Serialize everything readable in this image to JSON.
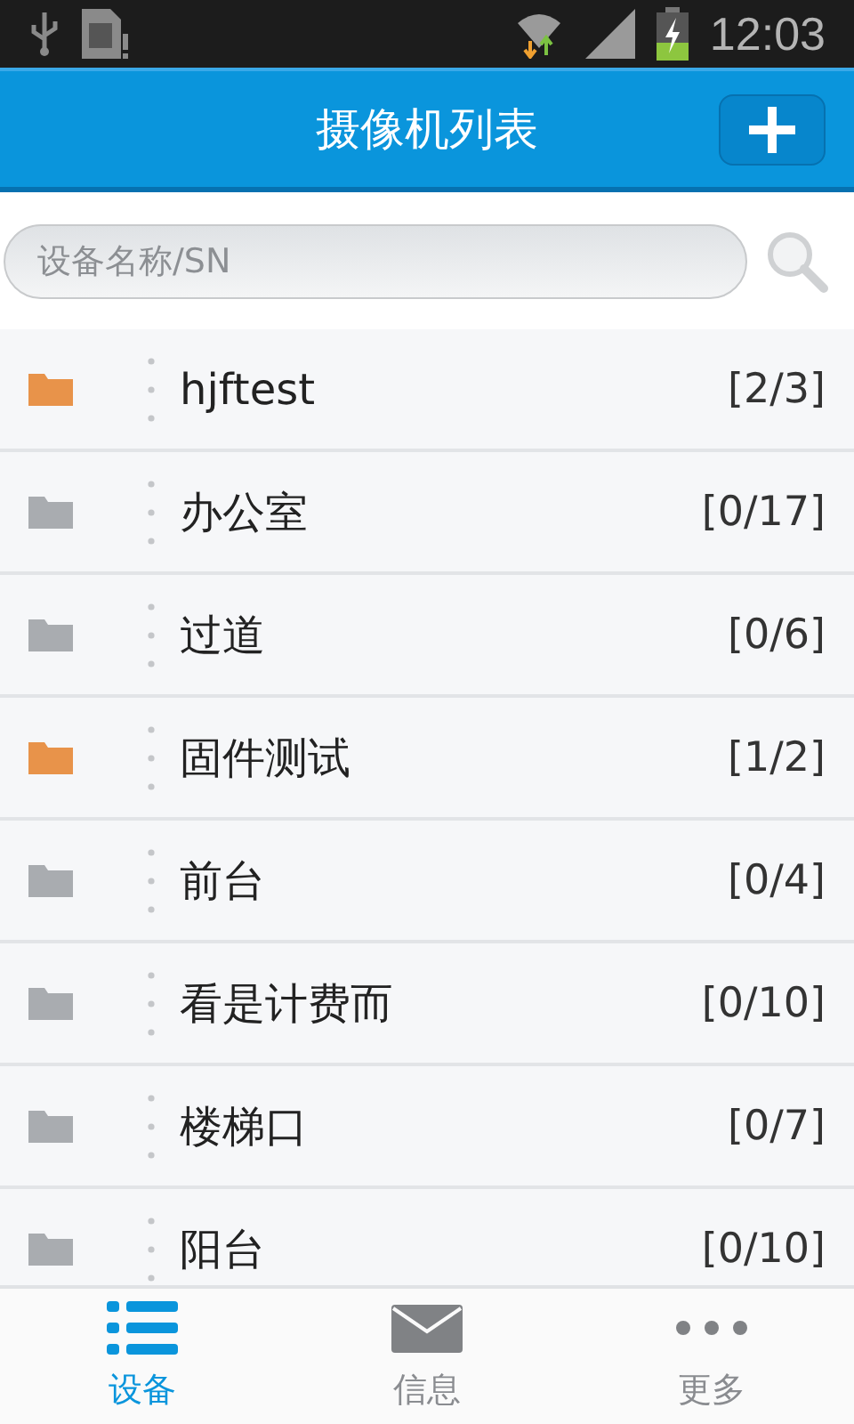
{
  "status_bar": {
    "time": "12:03"
  },
  "header": {
    "title": "摄像机列表"
  },
  "search": {
    "placeholder": "设备名称/SN"
  },
  "devices": [
    {
      "name": "hjftest",
      "count": "[2/3]",
      "color": "#e8934a"
    },
    {
      "name": "办公室",
      "count": "[0/17]",
      "color": "#a9acb0"
    },
    {
      "name": "过道",
      "count": "[0/6]",
      "color": "#a9acb0"
    },
    {
      "name": "固件测试",
      "count": "[1/2]",
      "color": "#e8934a"
    },
    {
      "name": "前台",
      "count": "[0/4]",
      "color": "#a9acb0"
    },
    {
      "name": "看是计费而",
      "count": "[0/10]",
      "color": "#a9acb0"
    },
    {
      "name": "楼梯口",
      "count": "[0/7]",
      "color": "#a9acb0"
    },
    {
      "name": "阳台",
      "count": "[0/10]",
      "color": "#a9acb0"
    }
  ],
  "tabs": [
    {
      "label": "设备",
      "kind": "list",
      "selected": true
    },
    {
      "label": "信息",
      "kind": "mail",
      "selected": false
    },
    {
      "label": "更多",
      "kind": "more",
      "selected": false
    }
  ]
}
